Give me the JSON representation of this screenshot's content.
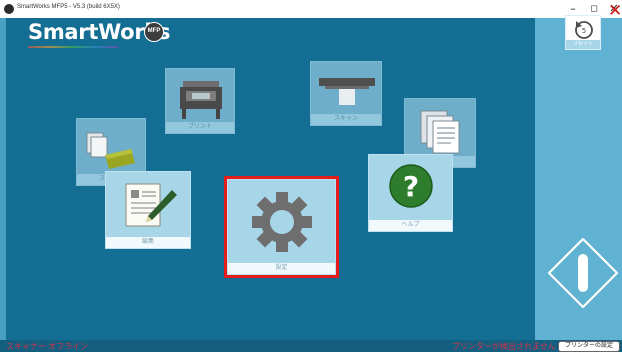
{
  "window": {
    "title": "SmartWorks MFP5 - V5.3 (build 6X5X)",
    "minimize_glyph": "–",
    "restore_glyph": "◻",
    "close_glyph": "✕"
  },
  "logo": {
    "text": "SmartWorks",
    "badge": "MFP"
  },
  "app_close_glyph": "✕",
  "tiles": {
    "print": {
      "label": "プリント",
      "icon": "printer-icon"
    },
    "scan": {
      "label": "スキャン",
      "icon": "scanner-icon"
    },
    "copy": {
      "label": "コピー",
      "icon": "copy-documents-icon"
    },
    "capture": {
      "label": "スキャン",
      "icon": "capture-icon"
    },
    "edit": {
      "label": "編集",
      "icon": "edit-document-icon"
    },
    "settings": {
      "label": "設定",
      "icon": "gear-icon"
    },
    "help": {
      "label": "ヘルプ",
      "icon": "help-icon"
    }
  },
  "reset": {
    "label": "リセット",
    "icon": "undo-arrow-icon"
  },
  "scroll_icon": "scroll-handle-icon",
  "status": {
    "capture": "スキャナー オフライン",
    "printer": "プリンターが検出されません",
    "printer_settings_button": "プリンターの設定"
  },
  "colors": {
    "panel": "#146d93",
    "background": "#4aa0c3",
    "tile": "#a7d6e9",
    "highlight": "#e41c1c",
    "status_text": "#d6304a",
    "close": "#d81818"
  }
}
